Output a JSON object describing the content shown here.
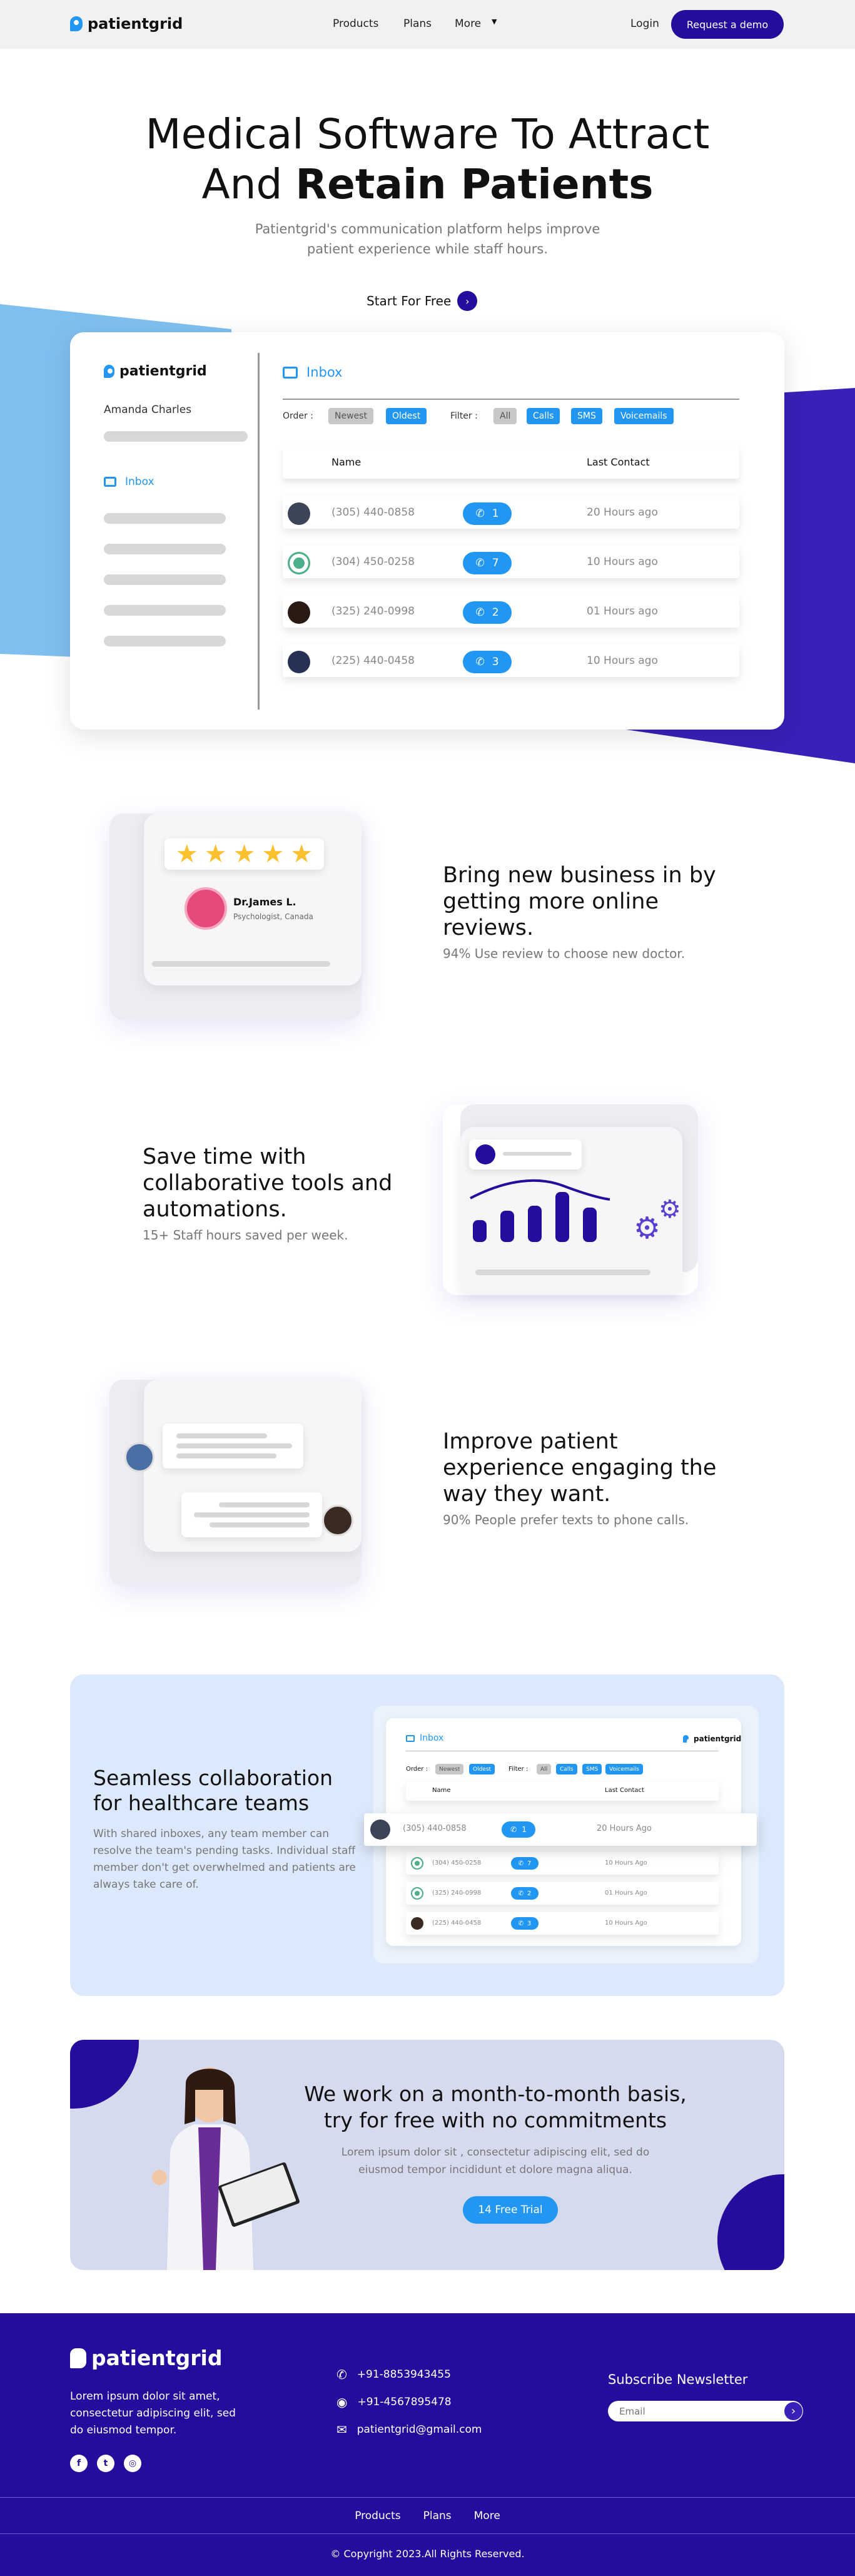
{
  "nav": {
    "brand": "patientgrid",
    "links": [
      "Products",
      "Plans",
      "More"
    ],
    "login": "Login",
    "demo": "Request a demo"
  },
  "hero": {
    "title_line1": "Medical Software To Attract",
    "title_line2_a": "And ",
    "title_line2_b": "Retain Patients",
    "subtitle_line1": "Patientgrid's communication platform helps improve",
    "subtitle_line2": "patient experience while staff hours.",
    "cta": "Start For Free"
  },
  "app": {
    "brand": "patientgrid",
    "user": "Amanda Charles",
    "sidebar_inbox": "Inbox",
    "inbox_title": "Inbox",
    "order_label": "Order :",
    "order_options": [
      "Newest",
      "Oldest"
    ],
    "filter_label": "Filter :",
    "filter_options": [
      "All",
      "Calls",
      "SMS",
      "Voicemails"
    ],
    "col_name": "Name",
    "col_last": "Last Contact",
    "rows": [
      {
        "phone": "(305) 440-0858",
        "count": "1",
        "last": "20 Hours ago"
      },
      {
        "phone": "(304) 450-0258",
        "count": "7",
        "last": "10 Hours ago"
      },
      {
        "phone": "(325) 240-0998",
        "count": "2",
        "last": "01 Hours ago"
      },
      {
        "phone": "(225) 440-0458",
        "count": "3",
        "last": "10 Hours ago"
      }
    ]
  },
  "features": [
    {
      "title": "Bring new business in by getting more online reviews.",
      "sub": "94% Use review to choose new doctor.",
      "doctor": "Dr.James L.",
      "doctor_role": "Psychologist, Canada"
    },
    {
      "title": "Save time with collaborative tools and automations.",
      "sub": "15+ Staff hours saved per week."
    },
    {
      "title": "Improve patient experience engaging the way they want.",
      "sub": "90% People prefer texts to phone calls."
    }
  ],
  "collab": {
    "title": "Seamless collaboration for healthcare teams",
    "body": "With shared inboxes, any team member can resolve the team's pending tasks. Individual staff member don't get overwhelmed and patients are always take care of.",
    "inbox": "Inbox",
    "brand": "patientgrid",
    "order": "Order :",
    "filter": "Filter :",
    "order_options": [
      "Newest",
      "Oldest"
    ],
    "filter_options": [
      "All",
      "Calls",
      "SMS",
      "Voicemails"
    ],
    "col_name": "Name",
    "col_last": "Last Contact",
    "rows": [
      {
        "phone": "(305) 440-0858",
        "count": "1",
        "last": "20 Hours Ago"
      },
      {
        "phone": "(304) 450-0258",
        "count": "7",
        "last": "10 Hours Ago"
      },
      {
        "phone": "(325) 240-0998",
        "count": "2",
        "last": "01 Hours Ago"
      },
      {
        "phone": "(225) 440-0458",
        "count": "3",
        "last": "10 Hours Ago"
      }
    ]
  },
  "pricing": {
    "title_line1": "We work on a month-to-month basis,",
    "title_line2": "try for free with no commitments",
    "body_line1": "Lorem ipsum dolor sit , consectetur adipiscing elit, sed do",
    "body_line2": "eiusmod tempor incididunt et dolore magna aliqua.",
    "cta": "14 Free Trial"
  },
  "footer": {
    "brand": "patientgrid",
    "tagline_line1": "Lorem ipsum dolor sit amet,",
    "tagline_line2": "consectetur adipiscing elit, sed",
    "tagline_line3": "do eiusmod tempor.",
    "phone": "+91-8853943455",
    "whatsapp": "+91-4567895478",
    "email": "patientgrid@gmail.com",
    "newsletter": "Subscribe Newsletter",
    "email_placeholder": "Email",
    "links": [
      "Products",
      "Plans",
      "More"
    ],
    "copyright": "© Copyright 2023.All Rights Reserved."
  },
  "colors": {
    "primary": "#260c9c",
    "accent": "#2196f3",
    "star": "#fbc02d"
  }
}
